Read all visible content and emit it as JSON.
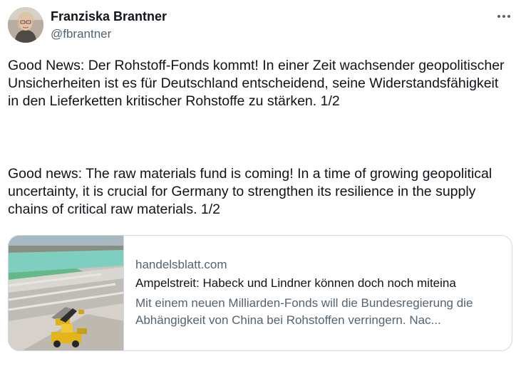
{
  "author": {
    "name": "Franziska Brantner",
    "handle": "@fbrantner",
    "avatar_icon": "profile-photo"
  },
  "more_icon": "ellipsis-horizontal-icon",
  "tweet": {
    "paragraph_de": "Good News: Der Rohstoff-Fonds kommt! In einer Zeit wachsender geopolitischer Unsicherheiten ist es für Deutschland entscheidend, seine Widerstandsfähigkeit in den Lieferketten kritischer Rohstoffe zu stärken. 1/2",
    "paragraph_en": "Good news: The raw materials fund is coming! In a time of growing geopolitical uncertainty, it is crucial for Germany to strengthen its resilience in the supply chains of critical raw materials. 1/2"
  },
  "link_card": {
    "domain": "handelsblatt.com",
    "title": "Ampelstreit: Habeck und Lindner können doch noch miteina",
    "description": "Mit einem neuen Milliarden-Fonds will die Bundesregierung die Abhängigkeit von China bei Rohstoffen verringern. Nac...",
    "image_icon": "mining-site-photo"
  },
  "colors": {
    "text_primary": "#0f1419",
    "text_secondary": "#536471",
    "border": "#cfd9de"
  }
}
